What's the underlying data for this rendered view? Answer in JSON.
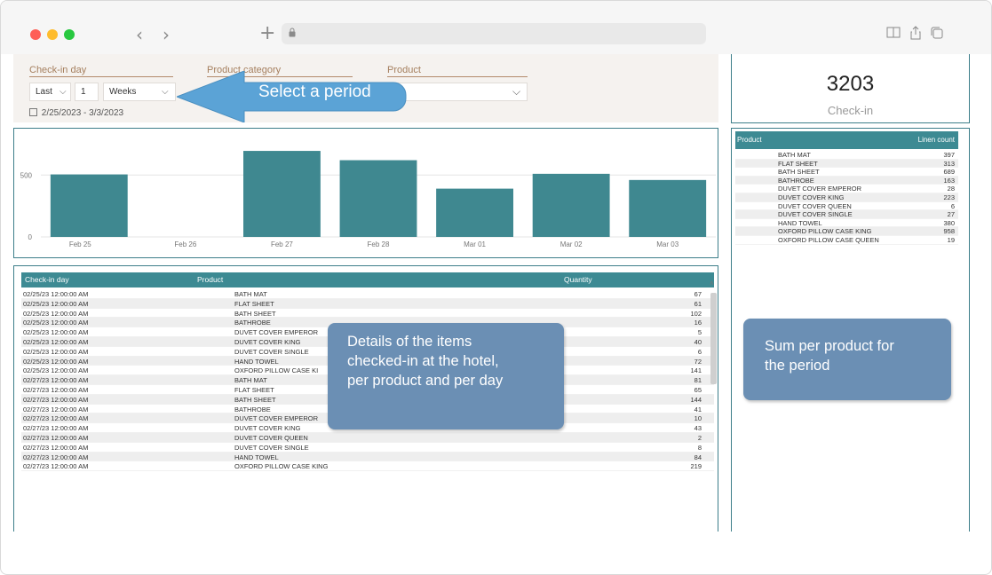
{
  "filters": {
    "checkin_label": "Check-in day",
    "category_label": "Product category",
    "product_label": "Product",
    "period_mode": "Last",
    "period_count": "1",
    "period_unit": "Weeks",
    "date_range": "2/25/2023 - 3/3/2023"
  },
  "callouts": {
    "select_period": "Select a period",
    "details_line1": "Details of the items",
    "details_line2": "checked-in at the hotel,",
    "details_line3": "per product and per day",
    "sum_line1": "Sum per product for",
    "sum_line2": "the period"
  },
  "kpi": {
    "value": "3203",
    "label": "Check-in"
  },
  "chart_data": {
    "type": "bar",
    "categories": [
      "Feb 25",
      "Feb 26",
      "Feb 27",
      "Feb 28",
      "Mar 01",
      "Mar 02",
      "Mar 03"
    ],
    "values": [
      505,
      0,
      695,
      620,
      390,
      510,
      460
    ],
    "y_ticks": [
      "0",
      "500"
    ],
    "ylim": [
      0,
      760
    ],
    "color": "#3f8890"
  },
  "details": {
    "columns": [
      "Check-in day",
      "Product",
      "Quantity"
    ],
    "rows": [
      [
        "02/25/23 12:00:00 AM",
        "BATH MAT",
        "67"
      ],
      [
        "02/25/23 12:00:00 AM",
        "FLAT SHEET",
        "61"
      ],
      [
        "02/25/23 12:00:00 AM",
        "BATH SHEET",
        "102"
      ],
      [
        "02/25/23 12:00:00 AM",
        "BATHROBE",
        "16"
      ],
      [
        "02/25/23 12:00:00 AM",
        "DUVET COVER EMPEROR",
        "5"
      ],
      [
        "02/25/23 12:00:00 AM",
        "DUVET COVER KING",
        "40"
      ],
      [
        "02/25/23 12:00:00 AM",
        "DUVET COVER SINGLE",
        "6"
      ],
      [
        "02/25/23 12:00:00 AM",
        "HAND TOWEL",
        "72"
      ],
      [
        "02/25/23 12:00:00 AM",
        "OXFORD PILLOW CASE KI",
        "141"
      ],
      [
        "02/27/23 12:00:00 AM",
        "BATH MAT",
        "81"
      ],
      [
        "02/27/23 12:00:00 AM",
        "FLAT SHEET",
        "65"
      ],
      [
        "02/27/23 12:00:00 AM",
        "BATH SHEET",
        "144"
      ],
      [
        "02/27/23 12:00:00 AM",
        "BATHROBE",
        "41"
      ],
      [
        "02/27/23 12:00:00 AM",
        "DUVET COVER EMPEROR",
        "10"
      ],
      [
        "02/27/23 12:00:00 AM",
        "DUVET COVER KING",
        "43"
      ],
      [
        "02/27/23 12:00:00 AM",
        "DUVET COVER QUEEN",
        "2"
      ],
      [
        "02/27/23 12:00:00 AM",
        "DUVET COVER SINGLE",
        "8"
      ],
      [
        "02/27/23 12:00:00 AM",
        "HAND TOWEL",
        "84"
      ],
      [
        "02/27/23 12:00:00 AM",
        "OXFORD PILLOW CASE KING",
        "219"
      ]
    ]
  },
  "summary": {
    "columns": [
      "Product",
      "Linen count"
    ],
    "rows": [
      [
        "BATH MAT",
        "397"
      ],
      [
        "FLAT SHEET",
        "313"
      ],
      [
        "BATH SHEET",
        "689"
      ],
      [
        "BATHROBE",
        "163"
      ],
      [
        "DUVET COVER EMPEROR",
        "28"
      ],
      [
        "DUVET COVER KING",
        "223"
      ],
      [
        "DUVET COVER QUEEN",
        "6"
      ],
      [
        "DUVET COVER SINGLE",
        "27"
      ],
      [
        "HAND TOWEL",
        "380"
      ],
      [
        "OXFORD PILLOW CASE KING",
        "958"
      ],
      [
        "OXFORD PILLOW CASE QUEEN",
        "19"
      ]
    ]
  },
  "colors": {
    "accent": "#3d8a93",
    "callout": "#6b8fb4",
    "arrow": "#5ba3d6"
  }
}
